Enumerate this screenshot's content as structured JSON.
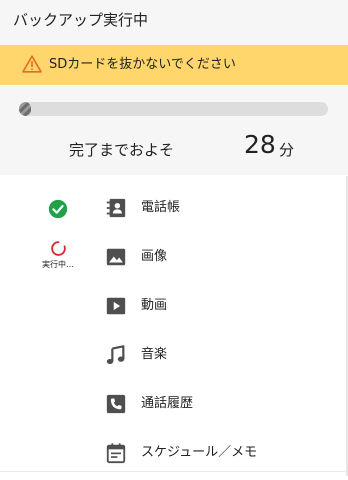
{
  "header": {
    "title": "バックアップ実行中"
  },
  "warning": {
    "text": "SDカードを抜かないでください",
    "background": "#ffd66b",
    "icon": "warning-icon"
  },
  "progress": {
    "fraction": 0.04,
    "eta_label": "完了までおよそ",
    "eta_value": "28",
    "eta_unit": "分"
  },
  "status": {
    "done_icon": "check-circle-icon",
    "done_color": "#1fa24a",
    "running_icon": "spinner-icon",
    "running_color": "#d9292e",
    "running_text": "実行中…"
  },
  "items": [
    {
      "label": "電話帳",
      "icon": "contacts-icon"
    },
    {
      "label": "画像",
      "icon": "image-icon"
    },
    {
      "label": "動画",
      "icon": "video-icon"
    },
    {
      "label": "音楽",
      "icon": "music-icon"
    },
    {
      "label": "通話履歴",
      "icon": "call-log-icon"
    },
    {
      "label": "スケジュール／メモ",
      "icon": "calendar-icon"
    }
  ]
}
